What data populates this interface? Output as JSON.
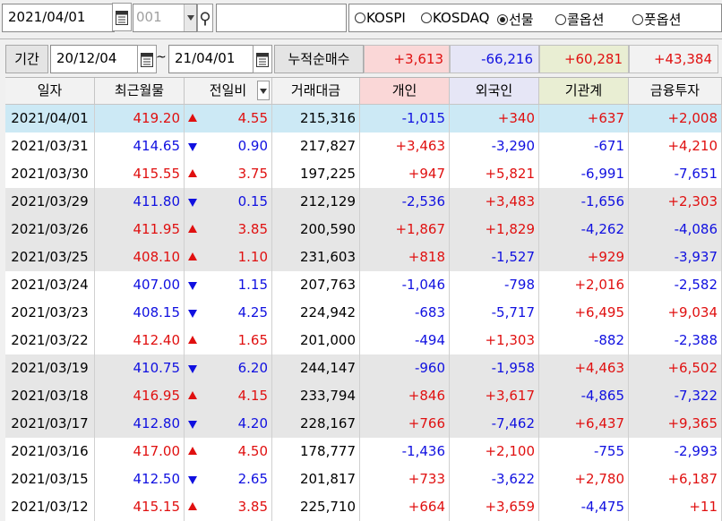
{
  "toolbar": {
    "date": "2021/04/01",
    "code": "001",
    "name": "",
    "radios": [
      {
        "label": "KOSPI",
        "selected": false
      },
      {
        "label": "KOSDAQ",
        "selected": false
      },
      {
        "label": "선물",
        "selected": true
      },
      {
        "label": "콜옵션",
        "selected": false
      },
      {
        "label": "풋옵션",
        "selected": false
      }
    ]
  },
  "period": {
    "label": "기간",
    "from": "20/12/04",
    "tilde": "~",
    "to": "21/04/01",
    "cum_label": "누적순매수",
    "cum_values": [
      {
        "value": "+3,613",
        "bg": "#fad7d7",
        "color": "#e01010"
      },
      {
        "value": "-66,216",
        "bg": "#e6e6f6",
        "color": "#1010e0"
      },
      {
        "value": "+60,281",
        "bg": "#e9eed3",
        "color": "#e01010"
      },
      {
        "value": "+43,384",
        "bg": "#f2f2f2",
        "color": "#e01010"
      }
    ]
  },
  "colors": {
    "up": "#e01010",
    "down": "#1010e0",
    "selected_row": "#cce9f5",
    "gray_row": "#e6e6e6",
    "white_row": "#ffffff"
  },
  "table": {
    "columns": [
      {
        "label": "일자",
        "bg": "#f2f2f2"
      },
      {
        "label": "최근월물",
        "bg": "#f2f2f2"
      },
      {
        "label": "전일비",
        "bg": "#f2f2f2"
      },
      {
        "label": "거래대금",
        "bg": "#f2f2f2"
      },
      {
        "label": "개인",
        "bg": "#fad7d7"
      },
      {
        "label": "외국인",
        "bg": "#e6e6f6"
      },
      {
        "label": "기관계",
        "bg": "#e9eed3"
      },
      {
        "label": "금융투자",
        "bg": "#f2f2f2"
      }
    ],
    "rows": [
      {
        "date": "2021/04/01",
        "price": "419.20",
        "dir": "up",
        "change": "4.55",
        "amount": "215,316",
        "indiv": "-1,015",
        "foreign": "+340",
        "inst": "+637",
        "fin": "+2,008",
        "bg": "selected"
      },
      {
        "date": "2021/03/31",
        "price": "414.65",
        "dir": "down",
        "change": "0.90",
        "amount": "217,827",
        "indiv": "+3,463",
        "foreign": "-3,290",
        "inst": "-671",
        "fin": "+4,210",
        "bg": "white"
      },
      {
        "date": "2021/03/30",
        "price": "415.55",
        "dir": "up",
        "change": "3.75",
        "amount": "197,225",
        "indiv": "+947",
        "foreign": "+5,821",
        "inst": "-6,991",
        "fin": "-7,651",
        "bg": "white"
      },
      {
        "date": "2021/03/29",
        "price": "411.80",
        "dir": "down",
        "change": "0.15",
        "amount": "212,129",
        "indiv": "-2,536",
        "foreign": "+3,483",
        "inst": "-1,656",
        "fin": "+2,303",
        "bg": "gray"
      },
      {
        "date": "2021/03/26",
        "price": "411.95",
        "dir": "up",
        "change": "3.85",
        "amount": "200,590",
        "indiv": "+1,867",
        "foreign": "+1,829",
        "inst": "-4,262",
        "fin": "-4,086",
        "bg": "gray"
      },
      {
        "date": "2021/03/25",
        "price": "408.10",
        "dir": "up",
        "change": "1.10",
        "amount": "231,603",
        "indiv": "+818",
        "foreign": "-1,527",
        "inst": "+929",
        "fin": "-3,937",
        "bg": "gray"
      },
      {
        "date": "2021/03/24",
        "price": "407.00",
        "dir": "down",
        "change": "1.15",
        "amount": "207,763",
        "indiv": "-1,046",
        "foreign": "-798",
        "inst": "+2,016",
        "fin": "-2,582",
        "bg": "white"
      },
      {
        "date": "2021/03/23",
        "price": "408.15",
        "dir": "down",
        "change": "4.25",
        "amount": "224,942",
        "indiv": "-683",
        "foreign": "-5,717",
        "inst": "+6,495",
        "fin": "+9,034",
        "bg": "white"
      },
      {
        "date": "2021/03/22",
        "price": "412.40",
        "dir": "up",
        "change": "1.65",
        "amount": "201,000",
        "indiv": "-494",
        "foreign": "+1,303",
        "inst": "-882",
        "fin": "-2,388",
        "bg": "white"
      },
      {
        "date": "2021/03/19",
        "price": "410.75",
        "dir": "down",
        "change": "6.20",
        "amount": "244,147",
        "indiv": "-960",
        "foreign": "-1,958",
        "inst": "+4,463",
        "fin": "+6,502",
        "bg": "gray"
      },
      {
        "date": "2021/03/18",
        "price": "416.95",
        "dir": "up",
        "change": "4.15",
        "amount": "233,794",
        "indiv": "+846",
        "foreign": "+3,617",
        "inst": "-4,865",
        "fin": "-7,322",
        "bg": "gray"
      },
      {
        "date": "2021/03/17",
        "price": "412.80",
        "dir": "down",
        "change": "4.20",
        "amount": "228,167",
        "indiv": "+766",
        "foreign": "-7,462",
        "inst": "+6,437",
        "fin": "+9,365",
        "bg": "gray"
      },
      {
        "date": "2021/03/16",
        "price": "417.00",
        "dir": "up",
        "change": "4.50",
        "amount": "178,777",
        "indiv": "-1,436",
        "foreign": "+2,100",
        "inst": "-755",
        "fin": "-2,993",
        "bg": "white"
      },
      {
        "date": "2021/03/15",
        "price": "412.50",
        "dir": "down",
        "change": "2.65",
        "amount": "201,817",
        "indiv": "+733",
        "foreign": "-3,622",
        "inst": "+2,780",
        "fin": "+6,187",
        "bg": "white"
      },
      {
        "date": "2021/03/12",
        "price": "415.15",
        "dir": "up",
        "change": "3.85",
        "amount": "225,710",
        "indiv": "+664",
        "foreign": "+3,659",
        "inst": "-4,475",
        "fin": "+11",
        "bg": "white"
      }
    ]
  }
}
